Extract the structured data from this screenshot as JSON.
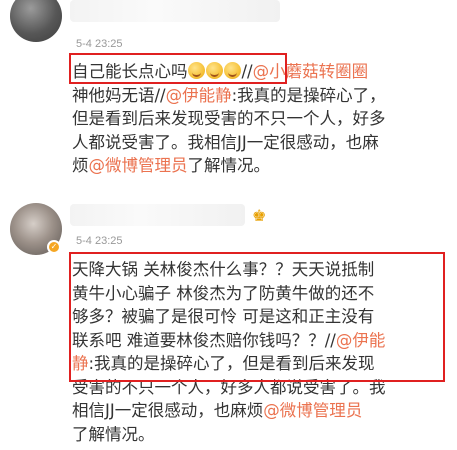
{
  "posts": [
    {
      "time": "5-4 23:25",
      "highlight": "自己能长点心吗",
      "emoji_count": 3,
      "rest_line1": "//",
      "mention_1": "@小蘑菇转圈圈",
      "line2_pre": "神他妈无语//",
      "mention_2": "@伊能静",
      "line2_post": ":我真的是操碎心了，",
      "line3": "但是看到后来发现受害的不只一个人，好多",
      "line4": "人都说受害了。我相信JJ一定很感动，也麻",
      "line5_pre": "烦",
      "mention_3": "@微博管理员",
      "line5_post": "了解情况。"
    },
    {
      "time": "5-4 23:25",
      "line1": "天降大锅 关林俊杰什么事？？天天说抵制",
      "line2": "黄牛小心骗子 林俊杰为了防黄牛做的还不",
      "line3": "够多？被骗了是很可怜 可是这和正主没有",
      "line4_pre": "联系吧 难道要林俊杰赔你钱吗？？//",
      "mention_1": "@伊能",
      "line5_mention": "静",
      "line5_post": ":我真的是操碎心了，但是看到后来发现",
      "line6": "受害的不只一个人，好多人都说受害了。我",
      "line7_pre": "相信JJ一定很感动，也麻烦",
      "mention_2": "@微博管理员",
      "line8": "了解情况。"
    }
  ],
  "colors": {
    "mention": "#eb7350",
    "highlight_border": "#e02020",
    "time": "#999999",
    "text": "#333333"
  },
  "icons": {
    "post1_emoji": "grinning-face-emoji",
    "post2_badge": "verified-badge-icon",
    "post2_crown": "crown-icon"
  }
}
